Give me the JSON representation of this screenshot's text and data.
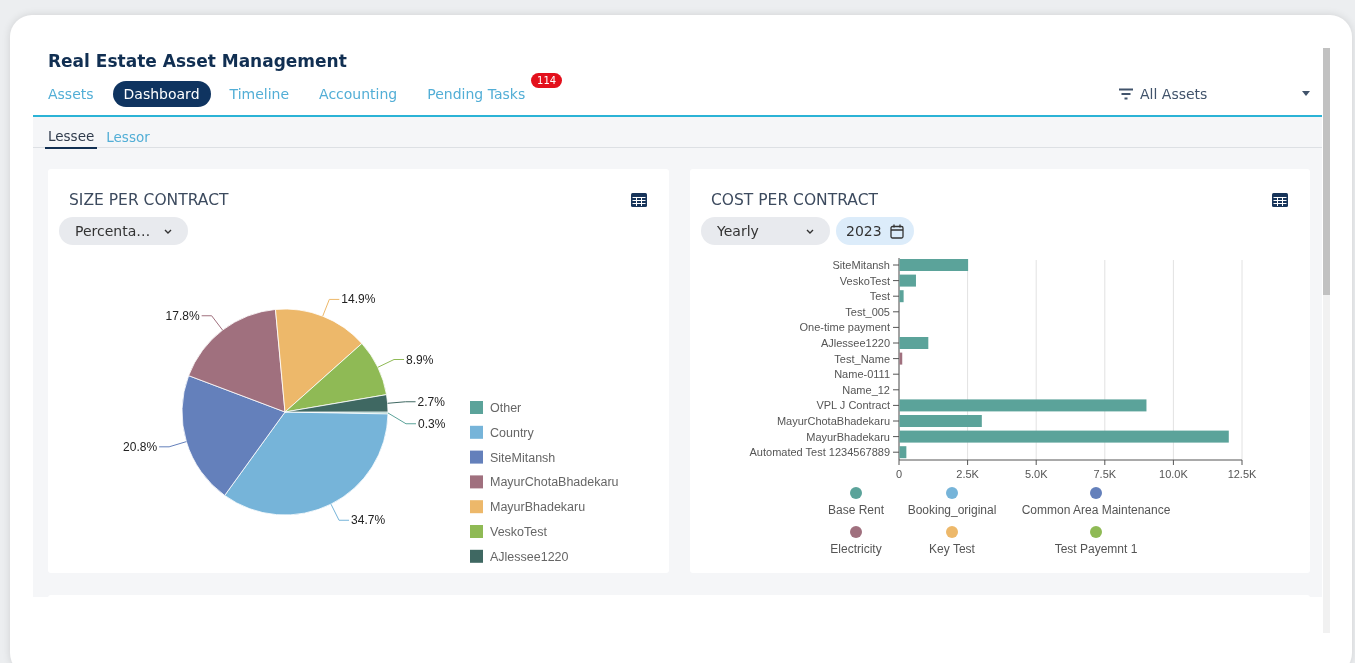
{
  "header": {
    "title": "Real Estate Asset Management"
  },
  "tabs": [
    {
      "label": "Assets",
      "selected": false
    },
    {
      "label": "Dashboard",
      "selected": true
    },
    {
      "label": "Timeline",
      "selected": false
    },
    {
      "label": "Accounting",
      "selected": false
    },
    {
      "label": "Pending Tasks",
      "selected": false,
      "badge": "114"
    }
  ],
  "filter": {
    "label": "All Assets"
  },
  "sub_tabs": [
    {
      "label": "Lessee",
      "selected": true
    },
    {
      "label": "Lessor",
      "selected": false
    }
  ],
  "size_card": {
    "title": "SIZE PER CONTRACT",
    "dropdown": {
      "value": "Percenta…"
    },
    "chart_data": {
      "type": "pie",
      "categories": [
        "Other",
        "Country",
        "SiteMitansh",
        "MayurChotaBhadekaru",
        "MayurBhadekaru",
        "VeskoTest",
        "AJlessee1220"
      ],
      "values": [
        0.3,
        34.7,
        20.8,
        17.8,
        14.9,
        8.9,
        2.7
      ],
      "colors": [
        "#5ba39a",
        "#76b4d9",
        "#6480bb",
        "#a0707e",
        "#edb86a",
        "#8fba55",
        "#3f6862"
      ],
      "value_labels": [
        "0.3%",
        "34.7%",
        "20.8%",
        "17.8%",
        "14.9%",
        "8.9%",
        "2.7%"
      ],
      "legend": true
    }
  },
  "cost_card": {
    "title": "COST PER CONTRACT",
    "period_dropdown": {
      "value": "Yearly"
    },
    "year_picker": {
      "value": "2023"
    },
    "chart_data": {
      "type": "bar",
      "orientation": "horizontal",
      "stacked": true,
      "categories": [
        "SiteMitansh",
        "VeskoTest",
        "Test",
        "Test_005",
        "One-time payment",
        "AJlessee1220",
        "Test_Name",
        "Name-0111",
        "Name_12",
        "VPL J Contract",
        "MayurChotaBhadekaru",
        "MayurBhadekaru",
        "Automated Test 1234567889"
      ],
      "series": [
        {
          "name": "Base Rent",
          "color": "#5ba39a",
          "values": [
            2500,
            600,
            150,
            null,
            null,
            1050,
            null,
            null,
            null,
            9000,
            3000,
            12000,
            250
          ]
        },
        {
          "name": "Booking_original",
          "color": "#76b4d9",
          "values": [
            null,
            null,
            null,
            null,
            null,
            null,
            null,
            null,
            null,
            null,
            null,
            null,
            null
          ]
        },
        {
          "name": "Common Area Maintenance",
          "color": "#6480bb",
          "values": [
            null,
            null,
            null,
            null,
            null,
            null,
            null,
            null,
            null,
            null,
            null,
            null,
            null
          ]
        },
        {
          "name": "Electricity",
          "color": "#a0707e",
          "values": [
            null,
            null,
            null,
            null,
            null,
            null,
            100,
            null,
            null,
            null,
            null,
            null,
            null
          ]
        },
        {
          "name": "Key Test",
          "color": "#edb86a",
          "values": [
            null,
            null,
            null,
            null,
            null,
            null,
            null,
            null,
            null,
            null,
            null,
            null,
            null
          ]
        },
        {
          "name": "Test Payemnt 1",
          "color": "#8fba55",
          "values": [
            null,
            null,
            null,
            null,
            null,
            null,
            null,
            null,
            null,
            null,
            null,
            null,
            null
          ]
        }
      ],
      "xlim": [
        0,
        12500
      ],
      "grid": true,
      "legend": true,
      "xticks": [
        {
          "value": 0,
          "label": "0"
        },
        {
          "value": 2500,
          "label": "2.5K"
        },
        {
          "value": 5000,
          "label": "5.0K"
        },
        {
          "value": 7500,
          "label": "7.5K"
        },
        {
          "value": 10000,
          "label": "10.0K"
        },
        {
          "value": 12500,
          "label": "12.5K"
        }
      ]
    }
  }
}
